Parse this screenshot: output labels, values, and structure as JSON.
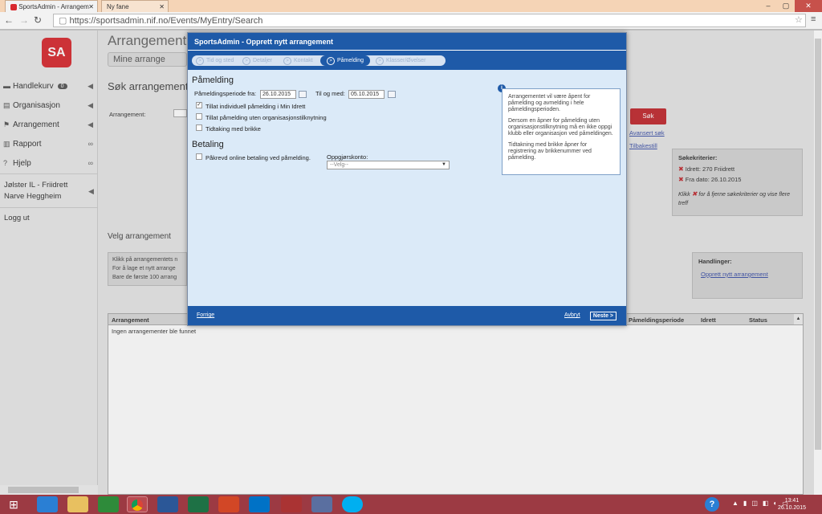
{
  "browser": {
    "tabs": [
      {
        "label": "SportsAdmin - Arrangem",
        "active": true
      },
      {
        "label": "Ny fane",
        "active": false
      }
    ],
    "url": "https://sportsadmin.nif.no/Events/MyEntry/Search"
  },
  "sidebar": {
    "logo": "SA",
    "items": [
      {
        "label": "Handlekurv",
        "badge": "0",
        "icon": "cart-icon"
      },
      {
        "label": "Organisasjon",
        "icon": "building-icon"
      },
      {
        "label": "Arrangement",
        "icon": "flag-icon"
      },
      {
        "label": "Rapport",
        "icon": "bar-chart-icon"
      },
      {
        "label": "Hjelp",
        "icon": "question-icon"
      }
    ],
    "org": "Jølster IL - Friidrett",
    "user": "Narve Heggheim",
    "logout": "Logg ut"
  },
  "main": {
    "title": "Arrangement",
    "subtab": "Mine arrange",
    "search_title": "Søk arrangement",
    "field_label": "Arrangement:",
    "choose_title": "Velg arrangement",
    "hint_lines": [
      "Klikk på arrangementets n",
      "For å lage et nytt arrange",
      "Bare de første 100 arrang"
    ],
    "search_button": "Søk",
    "advanced_link": "Avansert søk",
    "reset_link": "Tilbakestill",
    "criteria_title": "Søkekriterier:",
    "criteria": [
      "Idrett: 270 Friidrett",
      "Fra dato: 26.10.2015"
    ],
    "criteria_hint_pre": "Klikk",
    "criteria_hint_post": "for å fjerne søkekriterier og vise flere treff",
    "actions_title": "Handlinger:",
    "actions_link": "Opprett nytt arrangement",
    "table_headers": [
      "Arrangement",
      "Påmeldingsperiode",
      "Idrett",
      "Status"
    ],
    "empty": "Ingen arrangementer ble funnet"
  },
  "dialog": {
    "title": "SportsAdmin - Opprett nytt arrangement",
    "steps": [
      "Tid og sted",
      "Detaljer",
      "Kontakt",
      "Påmelding",
      "Klasser/Øvelser"
    ],
    "active_step": 3,
    "section1": "Påmelding",
    "period_from_label": "Påmeldingsperiode fra:",
    "period_from": "26.10.2015",
    "period_to_label": "Til og med:",
    "period_to": "05.10.2015",
    "check1": "Tillat individuell påmelding i Min Idrett",
    "check2": "Tillat påmelding uten organisasjonstilknytning",
    "check3": "Tidtaking med brikke",
    "section2": "Betaling",
    "check4": "Påkrevd online betaling ved påmelding.",
    "account_label": "Oppgjørskonto:",
    "account_value": "--Velg--",
    "info_p1": "Arrangementet vil være åpent for påmelding og avmelding i hele påmeldingsperioden.",
    "info_p2": "Dersom en åpner for påmelding uten organisasjonstilknytning må en ikke oppgi klubb eller organisasjon ved påmeldingen.",
    "info_p3": "Tidtakning med brikke åpner for registrering av brikkenummer ved påmelding.",
    "prev": "Forrige",
    "cancel": "Avbryt",
    "next": "Neste >"
  },
  "taskbar": {
    "time": "13:41",
    "date": "26.10.2015"
  }
}
